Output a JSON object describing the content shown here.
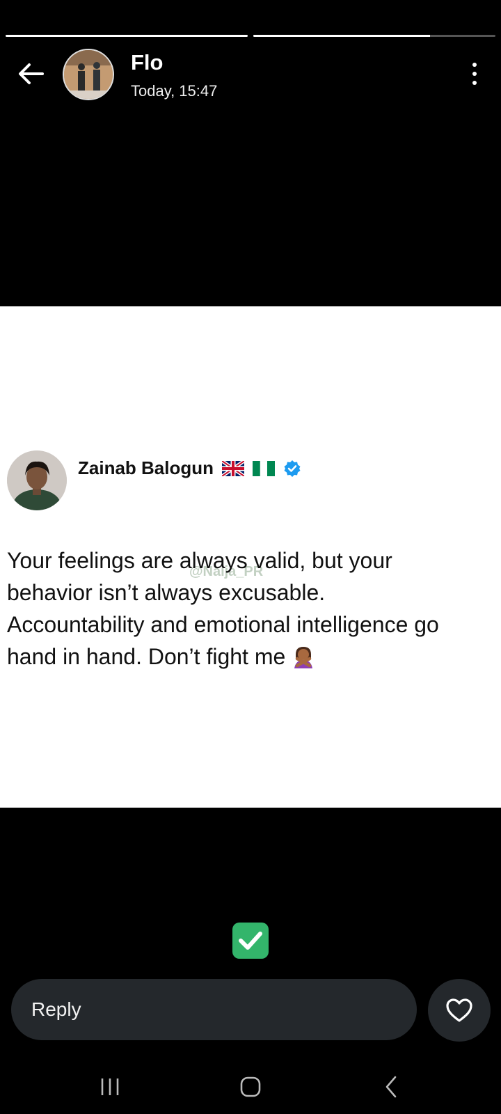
{
  "story": {
    "progress": [
      1.0,
      0.73
    ]
  },
  "header": {
    "back_icon": "arrow-left-icon",
    "username": "Flo",
    "timestamp": "Today, 15:47",
    "menu_icon": "more-vertical-icon"
  },
  "tweet": {
    "author": "Zainab Balogun",
    "flags": [
      "uk-flag-icon",
      "nigeria-flag-icon"
    ],
    "verified_icon": "verified-badge-icon",
    "text_lines": [
      "Your feelings are always valid, but your",
      "behavior isn’t always excusable.",
      "Accountability and emotional intelligence go",
      "hand in hand. Don’t fight me"
    ],
    "emoji": "woman-gesturing-no-icon",
    "watermark": "@Naija_PR"
  },
  "caption_icon": "check-mark-button-icon",
  "reply": {
    "label": "Reply",
    "like_icon": "heart-icon"
  },
  "system_nav": {
    "recents_icon": "recents-icon",
    "home_icon": "home-icon",
    "back_icon": "chevron-back-icon"
  },
  "colors": {
    "background": "#000000",
    "story_bg": "#ffffff",
    "input_bg": "#24282c",
    "check_green": "#33b56b",
    "verified_blue": "#1d9bf0"
  }
}
